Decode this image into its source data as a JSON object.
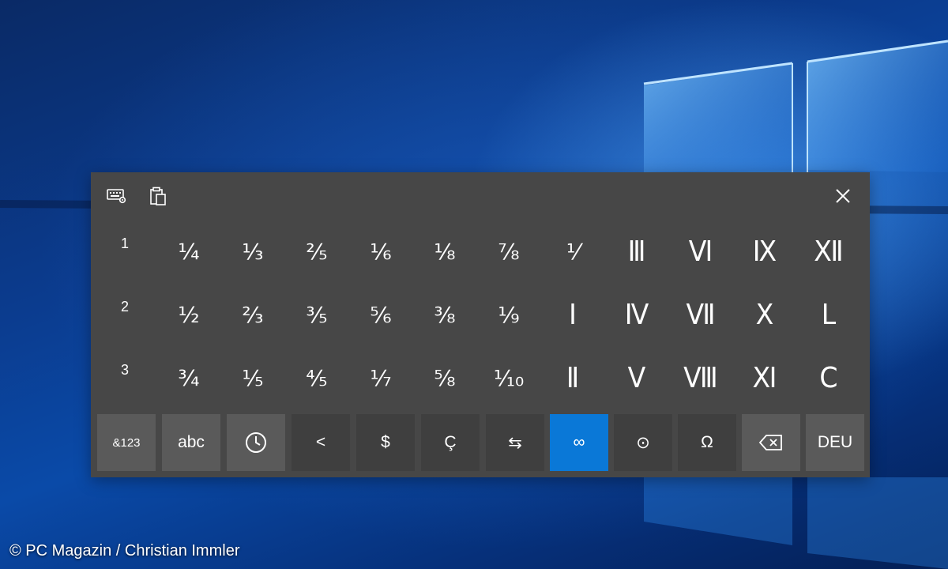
{
  "keyboard": {
    "row_numbers": [
      "1",
      "2",
      "3"
    ],
    "rows": [
      [
        "¼",
        "⅓",
        "⅖",
        "⅙",
        "⅛",
        "⅞",
        "⅟",
        "Ⅲ",
        "Ⅵ",
        "Ⅸ",
        "Ⅻ"
      ],
      [
        "½",
        "⅔",
        "⅗",
        "⅚",
        "⅜",
        "⅑",
        "Ⅰ",
        "Ⅳ",
        "Ⅶ",
        "Ⅹ",
        "Ⅼ"
      ],
      [
        "¾",
        "⅕",
        "⅘",
        "⅐",
        "⅝",
        "⅒",
        "Ⅱ",
        "Ⅴ",
        "Ⅷ",
        "Ⅺ",
        "Ⅽ"
      ]
    ],
    "bottom_row": {
      "numbers_label": "&123",
      "abc_label": "abc",
      "recent_icon": "clock-icon",
      "less_than_label": "<",
      "dollar_label": "$",
      "cedilla_label": "Ç",
      "arrows_label": "⇆",
      "infinity_label": "∞",
      "circle_dot_label": "⊙",
      "omega_label": "Ω",
      "backspace_icon": "backspace-icon",
      "language_label": "DEU"
    },
    "toolbar": {
      "settings_icon": "keyboard-settings-icon",
      "clipboard_icon": "clipboard-icon",
      "close_icon": "close-icon"
    },
    "colors": {
      "panel": "#474747",
      "key": "#5a5a5a",
      "active_key": "#0a78d7"
    }
  },
  "credit": "© PC Magazin / Christian Immler"
}
